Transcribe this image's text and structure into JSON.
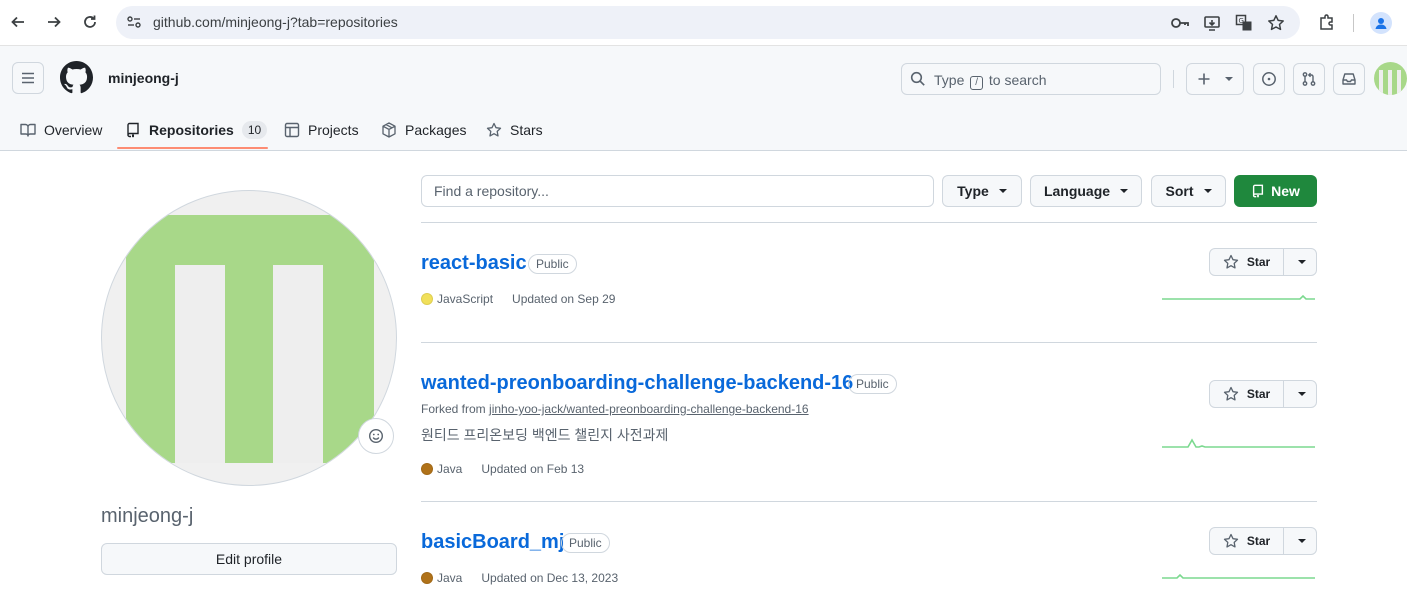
{
  "browser": {
    "url": "github.com/minjeong-j?tab=repositories"
  },
  "header": {
    "username": "minjeong-j",
    "search": {
      "prefix": "Type",
      "key": "/",
      "suffix": "to search"
    }
  },
  "tabs": [
    {
      "label": "Overview"
    },
    {
      "label": "Repositories",
      "count": "10"
    },
    {
      "label": "Projects"
    },
    {
      "label": "Packages"
    },
    {
      "label": "Stars"
    }
  ],
  "profile": {
    "name": "minjeong-j",
    "edit_label": "Edit profile"
  },
  "toolbar": {
    "find_placeholder": "Find a repository...",
    "type_label": "Type",
    "language_label": "Language",
    "sort_label": "Sort",
    "new_label": "New"
  },
  "repos": [
    {
      "name": "react-basic",
      "visibility": "Public",
      "language": "JavaScript",
      "language_color": "#f1e05a",
      "updated": "Updated on Sep 29",
      "star_label": "Star"
    },
    {
      "name": "wanted-preonboarding-challenge-backend-16",
      "visibility": "Public",
      "forked_prefix": "Forked from",
      "forked_from": "jinho-yoo-jack/wanted-preonboarding-challenge-backend-16",
      "description": "원티드 프리온보딩 백엔드 챌린지 사전과제",
      "language": "Java",
      "language_color": "#b07219",
      "updated": "Updated on Feb 13",
      "star_label": "Star"
    },
    {
      "name": "basicBoard_mj",
      "visibility": "Public",
      "language": "Java",
      "language_color": "#b07219",
      "updated": "Updated on Dec 13, 2023",
      "star_label": "Star"
    }
  ],
  "colors": {
    "accent_green": "#1f883d",
    "link_blue": "#0969da",
    "tab_underline": "#fd8c73",
    "avatar_green": "#a8d889"
  }
}
